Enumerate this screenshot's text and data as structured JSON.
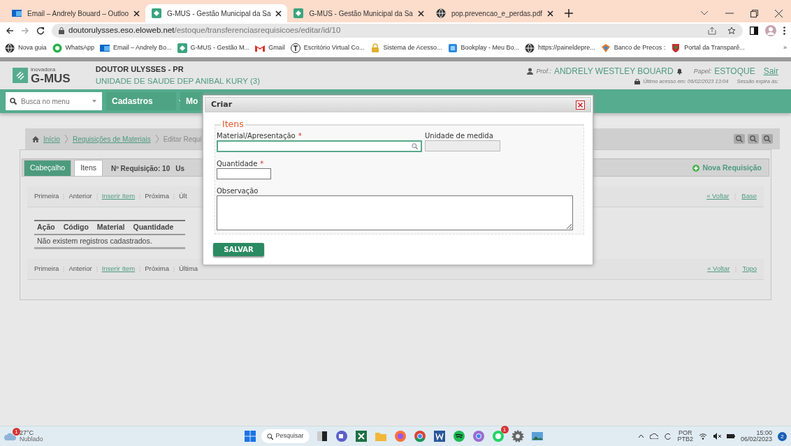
{
  "browser": {
    "tabs": [
      {
        "title": "Email – Andrely Bouard – Outloo",
        "kind": "mail",
        "selected": false
      },
      {
        "title": "G-MUS - Gestão Municipal da Sa",
        "kind": "gmus",
        "selected": true
      },
      {
        "title": "G-MUS - Gestão Municipal da Sa",
        "kind": "gmus",
        "selected": false
      },
      {
        "title": "pop.prevencao_e_perdas.pdf",
        "kind": "globe",
        "selected": false
      }
    ],
    "url_host": "doutorulysses.eso.eloweb.net",
    "url_path": "/estoque/transferenciasrequisicoes/editar/id/10",
    "bookmarks": [
      {
        "label": "Nova guia",
        "kind": "globe"
      },
      {
        "label": "WhatsApp",
        "kind": "whatsapp"
      },
      {
        "label": "Email – Andrely Bo...",
        "kind": "mail"
      },
      {
        "label": "G-MUS - Gestão M...",
        "kind": "gmus"
      },
      {
        "label": "Gmail",
        "kind": "gmail"
      },
      {
        "label": "Escritório Virtual Co...",
        "kind": "t"
      },
      {
        "label": "Sistema de Acesso...",
        "kind": "lock"
      },
      {
        "label": "Bookplay - Meu Bo...",
        "kind": "book"
      },
      {
        "label": "https://paineldepre...",
        "kind": "globe"
      },
      {
        "label": "Banco de Precos :",
        "kind": "bank"
      },
      {
        "label": "Portal da Transparê...",
        "kind": "shield"
      }
    ],
    "bookmarks_more": "»"
  },
  "header": {
    "logo_small": "inovadora",
    "logo": "G-MUS",
    "org": "DOUTOR ULYSSES - PR",
    "unit": "UNIDADE DE SAUDE DEP ANIBAL KURY (3)",
    "user_label": "Prof.:",
    "user": "ANDRELY WESTLEY BOUARD",
    "role_label": "Papel:",
    "role": "ESTOQUE",
    "logout": "Sair",
    "last_access": "Último acesso em: 06/02/2023 13:04",
    "session": "Sessão expira às:"
  },
  "nav": {
    "search_placeholder": "Busca no menu",
    "menus": [
      "Cadastros",
      "Mo"
    ]
  },
  "breadcrumb": [
    "Início",
    "Requisições de Materiais",
    "Editar Requi"
  ],
  "panel": {
    "tabs": [
      {
        "label": "Cabeçalho",
        "selected": false
      },
      {
        "label": "Itens",
        "selected": true
      }
    ],
    "info": [
      "Nº Requisição: 10",
      "Us"
    ],
    "new_button": "Nova Requisição",
    "pager_top": {
      "links": [
        {
          "label": "Primeira",
          "kind": "plain"
        },
        {
          "label": "Anterior",
          "kind": "plain"
        },
        {
          "label": "Inserir Item",
          "kind": "action"
        },
        {
          "label": "Próxima",
          "kind": "plain"
        },
        {
          "label": "Últ",
          "kind": "plain"
        }
      ],
      "right": [
        "« Voltar",
        "Base"
      ]
    },
    "table": {
      "columns": [
        "Ação",
        "Código",
        "Material",
        "Quantidade"
      ],
      "empty": "Não existem registros cadastrados."
    },
    "pager_bottom": {
      "links": [
        {
          "label": "Primeira",
          "kind": "plain"
        },
        {
          "label": "Anterior",
          "kind": "plain"
        },
        {
          "label": "Inserir Item",
          "kind": "action"
        },
        {
          "label": "Próxima",
          "kind": "plain"
        },
        {
          "label": "Última",
          "kind": "plain"
        }
      ],
      "right": [
        "« Voltar",
        "Topo"
      ]
    }
  },
  "modal": {
    "title": "Criar",
    "legend": "Itens",
    "fields": [
      {
        "label": "Material/Apresentação",
        "required_mark": "*",
        "kind": "lookup",
        "focused": true,
        "disabled": false
      },
      {
        "label": "Unidade de medida",
        "kind": "text",
        "focused": false,
        "disabled": true
      },
      {
        "label": "Quantidade",
        "required_mark": "*",
        "kind": "short",
        "focused": false,
        "disabled": false
      },
      {
        "label": "Observação",
        "kind": "textarea",
        "focused": false,
        "disabled": false
      }
    ],
    "save": "SALVAR"
  },
  "taskbar": {
    "temp": "27°C",
    "weather": "Nublado",
    "weather_badge": "1",
    "search": "Pesquisar",
    "apps": [
      {
        "kind": "files"
      },
      {
        "kind": "chat"
      },
      {
        "kind": "excel"
      },
      {
        "kind": "folder"
      },
      {
        "kind": "firefox"
      },
      {
        "kind": "chrome"
      },
      {
        "kind": "word"
      },
      {
        "kind": "spotify"
      },
      {
        "kind": "chrome2"
      },
      {
        "kind": "whatsapp",
        "badge": "1"
      },
      {
        "kind": "gear"
      },
      {
        "kind": "photo"
      }
    ],
    "lang1": "POR",
    "lang2": "PTB2",
    "time": "15:00",
    "date": "06/02/2023",
    "notifications": "2"
  }
}
